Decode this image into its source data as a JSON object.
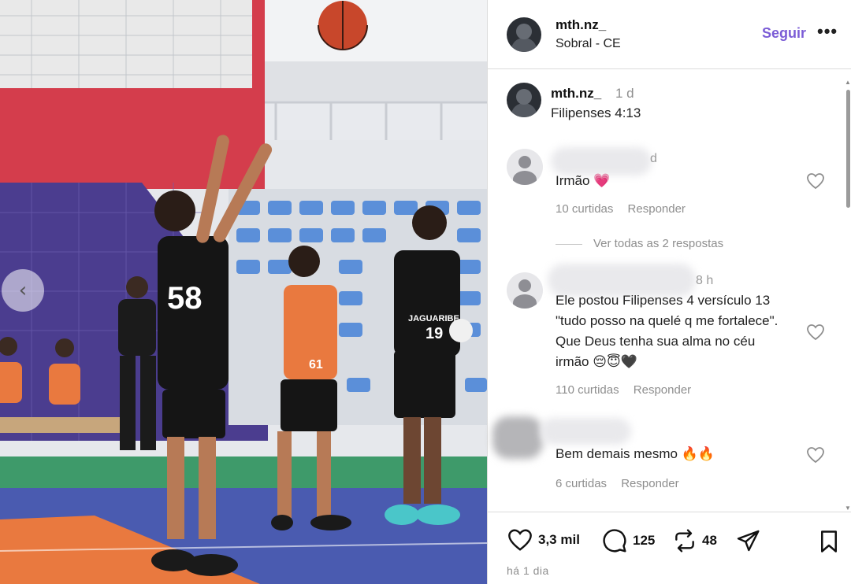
{
  "post": {
    "username": "mth.nz_",
    "location": "Sobral - CE",
    "follow_label": "Seguir",
    "more_icon": "more-options-icon",
    "caption": {
      "username": "mth.nz_",
      "time": "1 d",
      "text": "Filipenses 4:13"
    }
  },
  "photo": {
    "jersey_shooter": "58",
    "jersey_center": "19",
    "jersey_orange": "61",
    "jersey_word": "JAGUARIBE"
  },
  "comments": [
    {
      "time": "d",
      "text": "Irmão 💗",
      "likes": "10 curtidas",
      "reply_label": "Responder"
    },
    {
      "time": "8 h",
      "text": "Ele postou Filipenses 4 versículo 13 \"tudo posso na quelé q me fortalece\". Que Deus tenha sua alma no céu irmão 😔😇🖤",
      "likes": "110 curtidas",
      "reply_label": "Responder"
    },
    {
      "time": "",
      "text": "Bem demais mesmo 🔥🔥",
      "likes": "6 curtidas",
      "reply_label": "Responder"
    }
  ],
  "see_replies_label": "Ver todas as 2 respostas",
  "actions": {
    "likes": "3,3 mil",
    "comments": "125",
    "reposts": "48"
  },
  "timestamp": "há 1 dia",
  "colors": {
    "follow": "#7b5cd6",
    "court_orange": "#e9793f",
    "court_blue": "#4a5bb0"
  }
}
